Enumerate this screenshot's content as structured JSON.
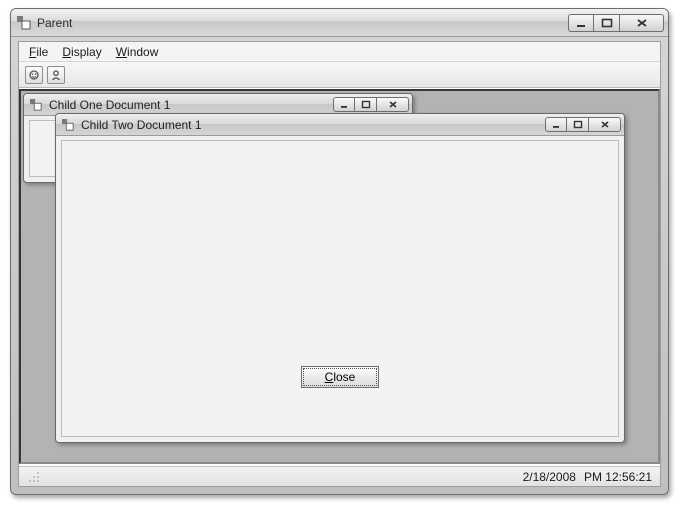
{
  "parent": {
    "title": "Parent"
  },
  "menu": {
    "file": "File",
    "display": "Display",
    "window": "Window"
  },
  "children": {
    "child1": {
      "title": "Child One Document 1"
    },
    "child2": {
      "title": "Child Two Document 1",
      "close_label": "Close"
    }
  },
  "status": {
    "date": "2/18/2008",
    "time": "PM 12:56:21"
  }
}
